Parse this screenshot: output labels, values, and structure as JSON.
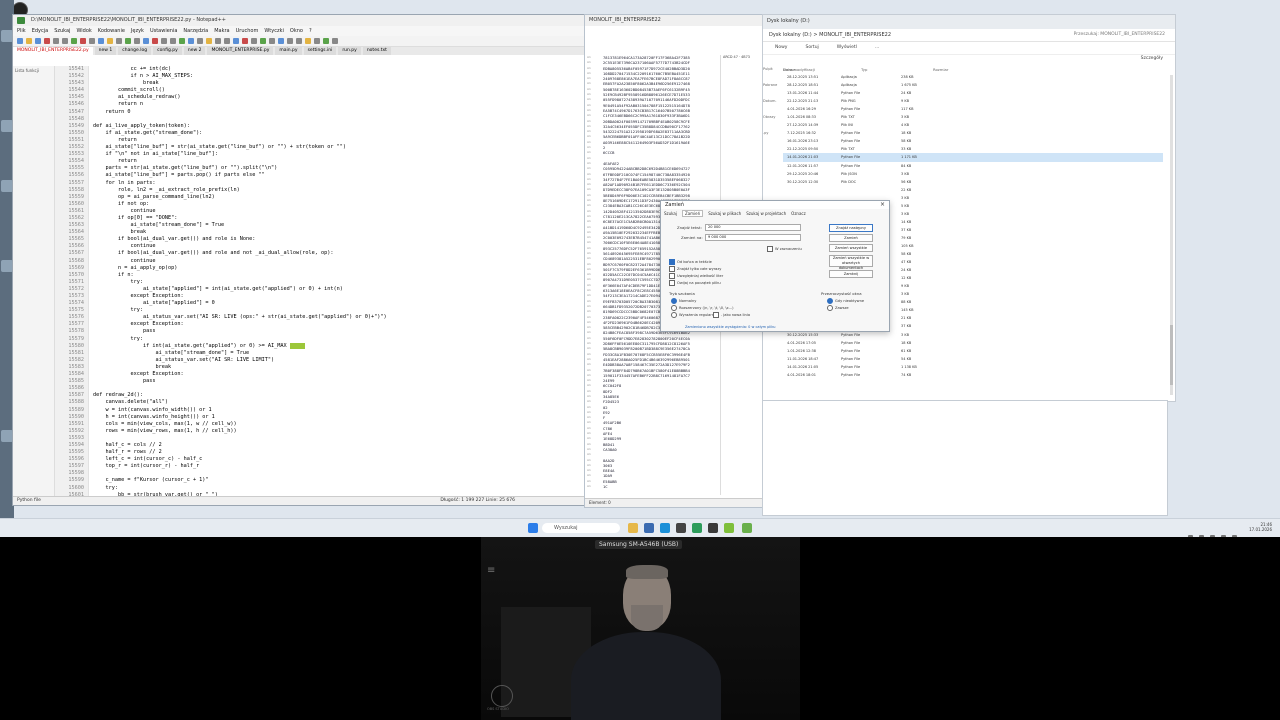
{
  "notepad": {
    "title": "D:\\MONOLIT_IBI_ENTERPRISE22\\MONOLIT_IBI_ENTERPRISE22.py - Notepad++",
    "menu": [
      "Plik",
      "Edycja",
      "Szukaj",
      "Widok",
      "Kodowanie",
      "Język",
      "Ustawienia",
      "Narzędzia",
      "Makra",
      "Uruchom",
      "Wtyczki",
      "Okno",
      "?"
    ],
    "tabs": [
      "MONOLIT_IBI_ENTERPRISE22.py",
      "new 1",
      "change.log",
      "config.py",
      "new 2",
      "MONOLIT_ENTERPRISE.py",
      "main.py",
      "settings.ini",
      "run.py",
      "notes.txt"
    ],
    "side_label": "Lista funkcji",
    "line_numbers": [
      "15541",
      "15542",
      "15543",
      "15544",
      "15545",
      "15546",
      "15547",
      "15548",
      "15549",
      "15550",
      "15551",
      "15552",
      "15553",
      "15554",
      "15555",
      "15556",
      "15557",
      "15558",
      "15559",
      "15560",
      "15561",
      "15562",
      "15563",
      "15564",
      "15565",
      "15566",
      "15567",
      "15568",
      "15569",
      "15570",
      "15571",
      "15572",
      "15573",
      "15574",
      "15575",
      "15576",
      "15577",
      "15578",
      "15579",
      "15580",
      "15581",
      "15582",
      "15583",
      "15584",
      "15585",
      "15586",
      "15587",
      "15588",
      "15589",
      "15590",
      "15591",
      "15592",
      "15593",
      "15594",
      "15595",
      "15596",
      "15597",
      "15598",
      "15599",
      "15600",
      "15601"
    ],
    "code_lines": [
      "            cc += int(dc)",
      "            if n > AI_MAX_STEPS:",
      "                break",
      "        commit_scroll()",
      "        ai_schedule_redraw()",
      "        return n",
      "    return 0",
      "",
      "def ai_live_apply_token(token):",
      "    if ai_state.get(\"stream_done\"):",
      "        return",
      "    ai_state[\"line_buf\"] = str(ai_state.get(\"line_buf\") or \"\") + str(token or \"\")",
      "    if \"\\n\" not in ai_state[\"line_buf\"]:",
      "        return",
      "    parts = str(ai_state.get(\"line_buf\") or \"\").split(\"\\n\")",
      "    ai_state[\"line_buf\"] = parts.pop() if parts else \"\"",
      "    for ln in parts:",
      "        role, ln2 = _ai_extract_role_prefix(ln)",
      "        op = ai_parse_command_line(ln2)",
      "        if not op:",
      "            continue",
      "        if op[0] == \"DONE\":",
      "            ai_state[\"stream_done\"] = True",
      "            break",
      "        if bool(ai_dual_var.get()) and role is None:",
      "            continue",
      "        if bool(ai_dual_var.get()) and role and not _ai_dual_allow(role, op):",
      "            continue",
      "        n = ai_apply_op(op)",
      "        if n:",
      "            try:",
      "                ai_state[\"applied\"] = int(ai_state.get(\"applied\") or 0) + int(n)",
      "            except Exception:",
      "                ai_state[\"applied\"] = 0",
      "            try:",
      "                ai_status_var.set(\"AI SR: LIVE (ops:\" + str(ai_state.get(\"applied\") or 0)+\")\")",
      "            except Exception:",
      "                pass",
      "            try:",
      "                if int(ai_state.get(\"applied\") or 0) >= AI_MAX",
      "                    ai_state[\"stream_done\"] = True",
      "                    ai_status_var.set(\"AI SR: LIVE LIMIT\")",
      "                    break",
      "            except Exception:",
      "                pass",
      "",
      "def redraw_2d():",
      "    canvas.delete(\"all\")",
      "    w = int(canvas.winfo_width()) or 1",
      "    h = int(canvas.winfo_height()) or 1",
      "    cols = min(view_cols, max(1, w // cell_w))",
      "    rows = min(view_rows, max(1, h // cell_h))",
      "",
      "    half_c = cols // 2",
      "    half_r = rows // 2",
      "    left_c = int(cursor_c) - half_c",
      "    top_r = int(cursor_r) - half_r",
      "",
      "    c_name = f\"Kursor (cursor_c + 1)\"",
      "    try:",
      "        bb = str(brush_var.get() or \" \")"
    ],
    "status": {
      "type": "Python file",
      "length": "Długość: 1 199 227   Linie: 25 676",
      "pos": "Linia: 15 603   Kolumna: 74   Zaznaczenie: 5 | 1",
      "eol": "Windows (CR LF)",
      "enc": "UTF-8",
      "ins": "INS"
    }
  },
  "hexview": {
    "title": "MONOLIT_IBI_ENTERPRISE22",
    "tab": "MONOLIT_IBI_ENTERPRISE22",
    "search_label": "Search filters & Filters",
    "right_header": "ARCD 47 · 4B73",
    "row_prefix": "A1",
    "status": "Element: 0"
  },
  "explorer": {
    "tab": "Dysk lokalny (D:)",
    "path": "Dysk lokalny (D:)   >   MONOLIT_IBI_ENTERPRISE22",
    "search": "Przeszukaj: MONOLIT_IBI_ENTERPRISE22",
    "toolbar": [
      "Nowy",
      "Sortuj",
      "Wyświetl",
      "..."
    ],
    "sort_label": "Szczegóły",
    "headers": [
      "Nazwa",
      "Data modyfikacji",
      "Typ",
      "Rozmiar"
    ],
    "rows": [
      {
        "date": "28.12.2025 13:51",
        "type": "Aplikacja",
        "size": "238 KB"
      },
      {
        "date": "28.12.2025 18:51",
        "type": "Aplikacja",
        "size": "1 675 KB"
      },
      {
        "date": "13.01.2026 11:44",
        "type": "Python File",
        "size": "24 KB"
      },
      {
        "date": "22.12.2025 21:13",
        "type": "Plik PNG",
        "size": "9 KB"
      },
      {
        "date": "4.01.2026 16:29",
        "type": "Python File",
        "size": "117 KB"
      },
      {
        "date": "1.01.2026 08:33",
        "type": "Plik TXT",
        "size": "3 KB"
      },
      {
        "date": "27.12.2025 14:39",
        "type": "Plik INI",
        "size": "4 KB"
      },
      {
        "date": "7.12.2025 16:32",
        "type": "Python File",
        "size": "18 KB"
      },
      {
        "date": "16.01.2026 23:13",
        "type": "Python File",
        "size": "58 KB"
      },
      {
        "date": "22.12.2025 09:50",
        "type": "Plik TXT",
        "size": "33 KB"
      },
      {
        "date": "14.01.2026 21:03",
        "type": "Python File",
        "size": "1 171 KB"
      },
      {
        "date": "12.01.2026 11:57",
        "type": "Python File",
        "size": "84 KB"
      },
      {
        "date": "29.12.2025 20:46",
        "type": "Plik JSON",
        "size": "3 KB"
      },
      {
        "date": "30.12.2025 12:30",
        "type": "Plik DOC",
        "size": "56 KB"
      },
      {
        "date": "",
        "type": "",
        "size": "22 KB"
      },
      {
        "date": "",
        "type": "",
        "size": "3 KB"
      },
      {
        "date": "",
        "type": "",
        "size": "5 KB"
      },
      {
        "date": "",
        "type": "",
        "size": "3 KB"
      },
      {
        "date": "",
        "type": "",
        "size": "14 KB"
      },
      {
        "date": "",
        "type": "",
        "size": "37 KB"
      },
      {
        "date": "",
        "type": "",
        "size": "79 KB"
      },
      {
        "date": "",
        "type": "",
        "size": "105 KB"
      },
      {
        "date": "",
        "type": "",
        "size": "58 KB"
      },
      {
        "date": "",
        "type": "",
        "size": "47 KB"
      },
      {
        "date": "",
        "type": "",
        "size": "24 KB"
      },
      {
        "date": "",
        "type": "",
        "size": "12 KB"
      },
      {
        "date": "",
        "type": "",
        "size": "9 KB"
      },
      {
        "date": "",
        "type": "",
        "size": "3 KB"
      },
      {
        "date": "",
        "type": "",
        "size": "88 KB"
      },
      {
        "date": "",
        "type": "",
        "size": "145 KB"
      },
      {
        "date": "",
        "type": "",
        "size": "21 KB"
      },
      {
        "date": "",
        "type": "",
        "size": "37 KB"
      },
      {
        "date": "30.12.2025 15:33",
        "type": "Python File",
        "size": "3 KB"
      },
      {
        "date": "4.01.2026 17:05",
        "type": "Python File",
        "size": "18 KB"
      },
      {
        "date": "1.01.2026 12:38",
        "type": "Python File",
        "size": "61 KB"
      },
      {
        "date": "11.01.2026 18:47",
        "type": "Python File",
        "size": "54 KB"
      },
      {
        "date": "14.01.2026 21:05",
        "type": "Python File",
        "size": "1 138 KB"
      },
      {
        "date": "4.01.2026 18:01",
        "type": "Python File",
        "size": "74 KB"
      }
    ],
    "side_items": [
      "Pulpit",
      "Pobrane",
      "Dokum.",
      "Obrazy",
      ".py"
    ]
  },
  "dialog": {
    "title": "Zamień",
    "tabs": [
      "Szukaj",
      "Zamień",
      "Szukaj w plikach",
      "Szukaj w projektach",
      "Oznacz"
    ],
    "find_label": "Znajdź tekst:",
    "find_value": "20 000",
    "replace_label": "Zamień na:",
    "replace_value": "9 000 000",
    "in_selection": "W zaznaczeniu",
    "buttons": [
      "Znajdź następny",
      "Zamień",
      "Zamień wszystkie",
      "Zamień wszystkie w otwartych dokumentach",
      "Zamknij"
    ],
    "options": [
      "Od końca w tekście",
      "Znajdź tylko całe wyrazy",
      "Uwzględniaj wielkość liter",
      "Owijaj na początek pliku"
    ],
    "mode_title": "Tryb szukania",
    "modes": [
      "Normalny",
      "Rozszerzony (\\n, \\r, \\t, \\0, \\x...)",
      "Wyrażenia regularne",
      ". jako nowa linia"
    ],
    "transp_title": "Przezroczystość okna",
    "transp": [
      "Gdy nieaktywne",
      "Zawsze"
    ],
    "status": "Zamieniono wszystkie wystąpienia: 0 w całym pliku"
  },
  "taskbar": {
    "search": "Wyszukaj",
    "time": "21:46",
    "date": "17.01.2026"
  },
  "camera": {
    "device": "Samsung SM-A546B (USB)",
    "logo_text": "OBS STUDIO",
    "menu_icon": "≡"
  }
}
